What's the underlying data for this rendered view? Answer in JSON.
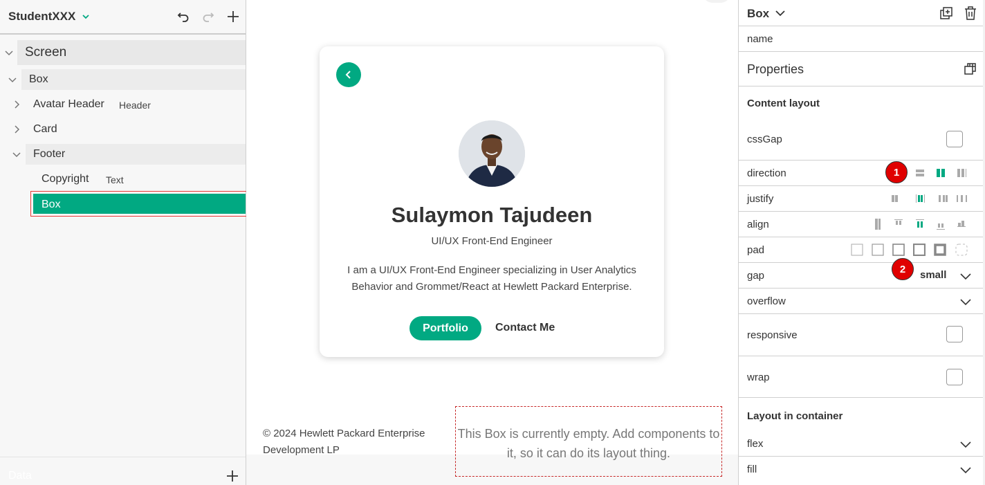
{
  "left_panel": {
    "app_title": "StudentXXX",
    "tree": {
      "screen": "Screen",
      "box": "Box",
      "avatar_header": "Avatar Header",
      "avatar_header_type": "Header",
      "card": "Card",
      "footer": "Footer",
      "copyright": "Copyright",
      "copyright_type": "Text",
      "selected_box": "Box"
    },
    "data_label": "Data"
  },
  "canvas": {
    "profile": {
      "name": "Sulaymon Tajudeen",
      "role": "UI/UX Front-End Engineer",
      "bio": "I am a UI/UX Front-End Engineer specializing in User Analytics Behavior and Grommet/React at Hewlett Packard Enterprise.",
      "portfolio_label": "Portfolio",
      "contact_label": "Contact Me"
    },
    "footer": {
      "copyright": "© 2024 Hewlett Packard Enterprise Development LP",
      "empty_box_message": "This Box is currently empty. Add components to it, so it can do its layout thing."
    }
  },
  "right_panel": {
    "component": "Box",
    "name_label": "name",
    "properties_title": "Properties",
    "content_layout": "Content layout",
    "css_gap": "cssGap",
    "direction": "direction",
    "justify": "justify",
    "align": "align",
    "pad": "pad",
    "gap": "gap",
    "gap_value": "small",
    "overflow": "overflow",
    "responsive": "responsive",
    "wrap": "wrap",
    "layout_in_container": "Layout in container",
    "flex": "flex",
    "fill": "fill",
    "annotations": [
      "1",
      "2"
    ]
  },
  "colors": {
    "accent": "#01a982",
    "badge": "#e00000",
    "selection_outline": "#e53935"
  }
}
